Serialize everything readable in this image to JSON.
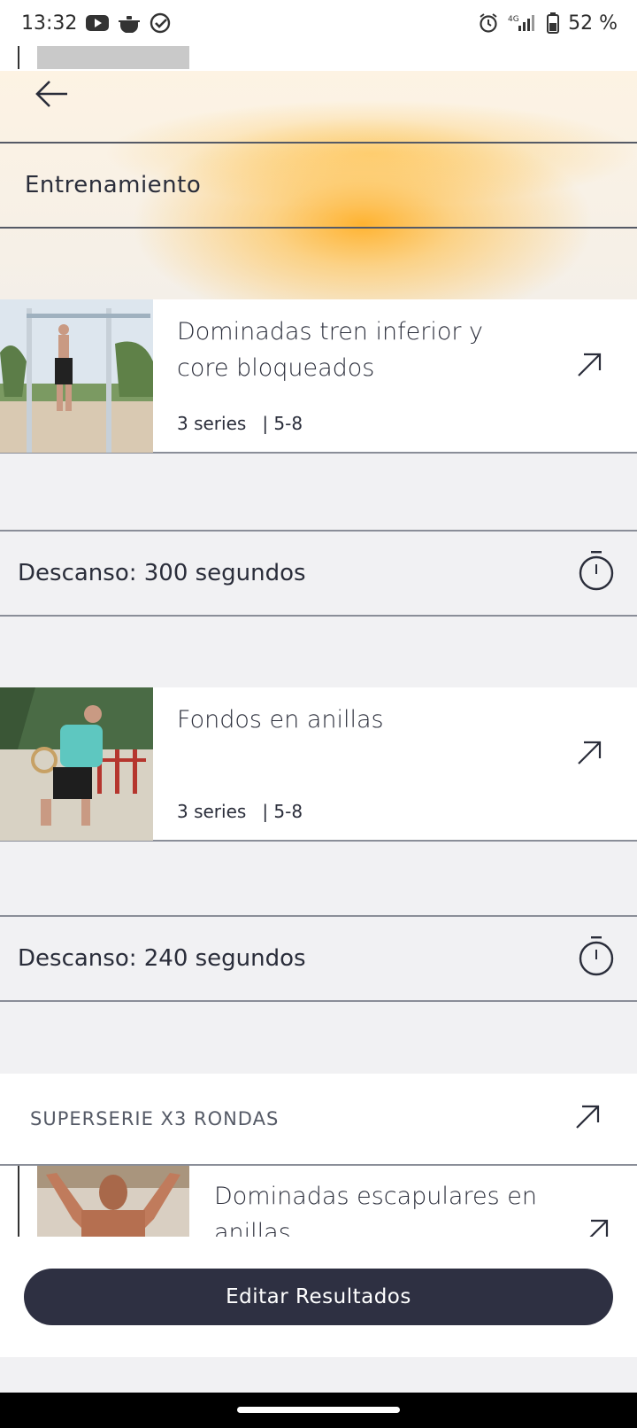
{
  "status_bar": {
    "time": "13:32",
    "battery_percent": "52 %",
    "network": "4G",
    "icons": [
      "youtube-icon",
      "cooking-pot-icon",
      "check-circle-icon",
      "alarm-icon",
      "signal-icon",
      "battery-icon"
    ]
  },
  "header": {
    "back_icon": "back-arrow-icon",
    "section_title": "Entrenamiento"
  },
  "exercises": [
    {
      "title": "Dominadas tren inferior y core bloqueados",
      "series": "3 series",
      "reps": "| 5-8",
      "open_icon": "external-arrow-icon"
    },
    {
      "title": "Fondos en anillas",
      "series": "3 series",
      "reps": "| 5-8",
      "open_icon": "external-arrow-icon"
    }
  ],
  "rests": [
    {
      "label": "Descanso: 300 segundos",
      "icon": "stopwatch-icon"
    },
    {
      "label": "Descanso: 240 segundos",
      "icon": "stopwatch-icon"
    }
  ],
  "superset": {
    "label": "SUPERSERIE X3 RONDAS",
    "open_icon": "external-arrow-icon",
    "first_exercise": {
      "title": "Dominadas escapulares en anillas"
    }
  },
  "actions": {
    "edit_results_label": "Editar Resultados"
  },
  "colors": {
    "accent_orange": "#ffb028",
    "button_dark": "#2e3042",
    "text_dark": "#2a2d3a",
    "background": "#f1f1f3"
  }
}
